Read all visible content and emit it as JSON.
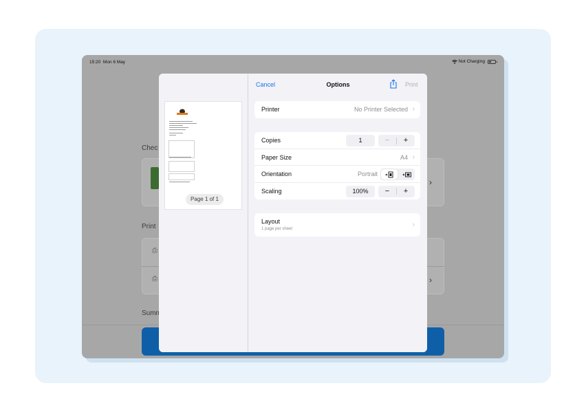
{
  "statusbar": {
    "time": "15:20",
    "date": "Mon 6 May",
    "charging": "Not Charging"
  },
  "background_app": {
    "section1": "Chec",
    "section2": "Print",
    "section3": "Summ"
  },
  "preview": {
    "page_label": "Page 1 of 1"
  },
  "nav": {
    "cancel": "Cancel",
    "title": "Options",
    "print": "Print"
  },
  "printer": {
    "label": "Printer",
    "value": "No Printer Selected"
  },
  "copies": {
    "label": "Copies",
    "value": "1",
    "minus": "−",
    "plus": "+"
  },
  "paper_size": {
    "label": "Paper Size",
    "value": "A4"
  },
  "orientation": {
    "label": "Orientation",
    "value": "Portrait"
  },
  "scaling": {
    "label": "Scaling",
    "value": "100%",
    "minus": "−",
    "plus": "+"
  },
  "layout": {
    "label": "Layout",
    "sub": "1 page per sheet"
  },
  "colors": {
    "accent": "#1a73e8",
    "disabled": "#b0b0b5",
    "primary_button": "#0f5fa8"
  },
  "icons": {
    "share": "share-icon",
    "chevron": "chevron-right-icon",
    "wifi": "wifi-icon",
    "battery": "battery-icon",
    "portrait": "portrait-orientation-icon",
    "landscape": "landscape-orientation-icon"
  }
}
